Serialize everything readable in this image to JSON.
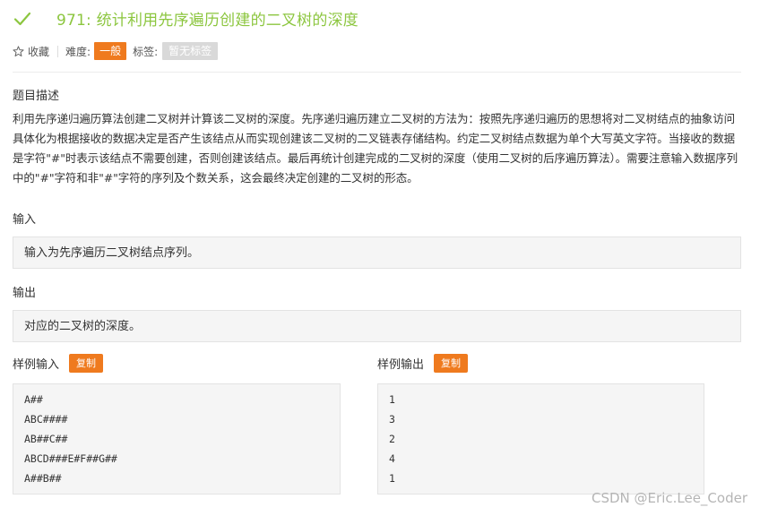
{
  "problem": {
    "title": "971: 统计利用先序遍历创建的二叉树的深度",
    "status_color": "#8cc63f"
  },
  "meta": {
    "favorite_label": "收藏",
    "difficulty_label": "难度:",
    "difficulty_value": "一般",
    "tags_label": "标签:",
    "tags_value": "暂无标签",
    "difficulty_color": "#ef7a1e"
  },
  "description": {
    "heading": "题目描述",
    "text": "利用先序递归遍历算法创建二叉树并计算该二叉树的深度。先序递归遍历建立二叉树的方法为：按照先序递归遍历的思想将对二叉树结点的抽象访问具体化为根据接收的数据决定是否产生该结点从而实现创建该二叉树的二叉链表存储结构。约定二叉树结点数据为单个大写英文字符。当接收的数据是字符\"#\"时表示该结点不需要创建，否则创建该结点。最后再统计创建完成的二叉树的深度（使用二叉树的后序遍历算法）。需要注意输入数据序列中的\"#\"字符和非\"#\"字符的序列及个数关系，这会最终决定创建的二叉树的形态。"
  },
  "input": {
    "heading": "输入",
    "text": "输入为先序遍历二叉树结点序列。"
  },
  "output": {
    "heading": "输出",
    "text": "对应的二叉树的深度。"
  },
  "sample_input": {
    "heading": "样例输入",
    "copy_label": "复制",
    "lines": [
      "A##",
      "ABC####",
      "AB##C##",
      "ABCD###E#F##G##",
      "A##B##"
    ]
  },
  "sample_output": {
    "heading": "样例输出",
    "copy_label": "复制",
    "lines": [
      "1",
      "3",
      "2",
      "4",
      "1"
    ]
  },
  "watermark": "CSDN @Eric.Lee_Coder"
}
